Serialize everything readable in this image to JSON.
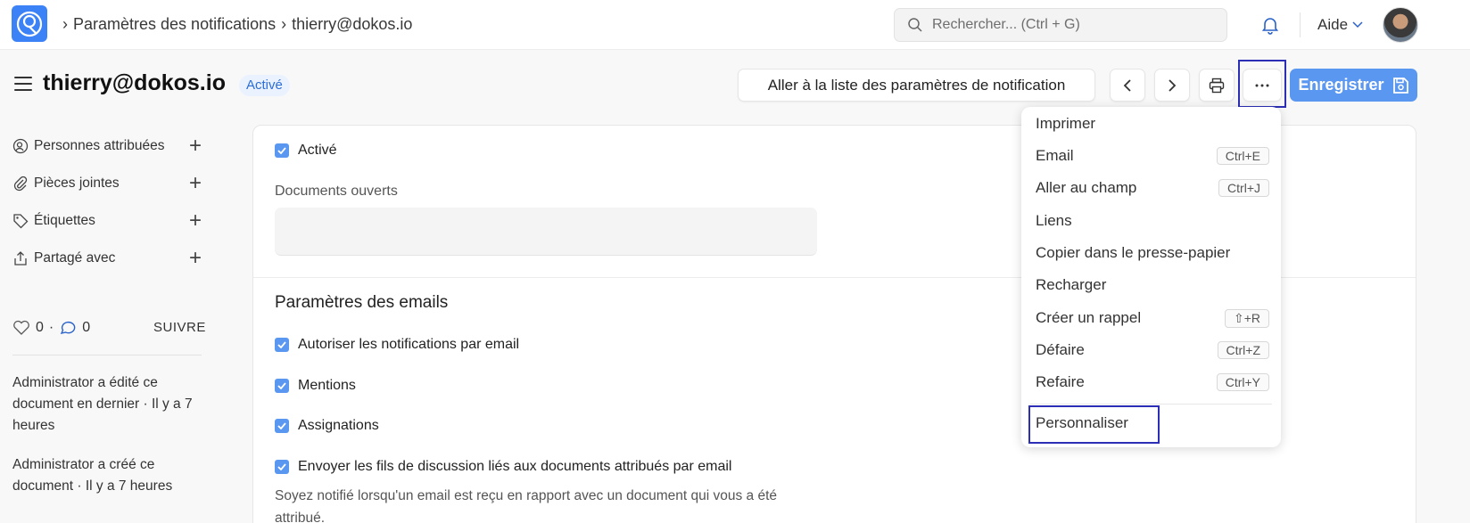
{
  "navbar": {
    "breadcrumb": [
      "Paramètres des notifications",
      "thierry@dokos.io"
    ],
    "search_placeholder": "Rechercher... (Ctrl + G)",
    "help_label": "Aide"
  },
  "header": {
    "title": "thierry@dokos.io",
    "status": "Activé",
    "list_button": "Aller à la liste des paramètres de notification",
    "save_button": "Enregistrer"
  },
  "sidebar": {
    "items": [
      {
        "label": "Personnes attribuées",
        "icon": "user-plus-icon"
      },
      {
        "label": "Pièces jointes",
        "icon": "paperclip-icon"
      },
      {
        "label": "Étiquettes",
        "icon": "tag-icon"
      },
      {
        "label": "Partagé avec",
        "icon": "share-icon"
      }
    ],
    "likes": "0",
    "comments": "0",
    "follow_label": "SUIVRE",
    "activity": [
      "Administrator a édité ce document en dernier · Il y a 7 heures",
      "Administrator a créé ce document · Il y a 7 heures"
    ]
  },
  "form": {
    "enabled_label": "Activé",
    "documents_label": "Documents ouverts",
    "email_section_title": "Paramètres des emails",
    "checkboxes": [
      "Autoriser les notifications par email",
      "Mentions",
      "Assignations",
      "Envoyer les fils de discussion liés aux documents attribués par email"
    ],
    "help_text": "Soyez notifié lorsqu'un email est reçu en rapport avec un document qui vous a été attribué."
  },
  "menu": {
    "items": [
      {
        "label": "Imprimer",
        "shortcut": ""
      },
      {
        "label": "Email",
        "shortcut": "Ctrl+E"
      },
      {
        "label": "Aller au champ",
        "shortcut": "Ctrl+J"
      },
      {
        "label": "Liens",
        "shortcut": ""
      },
      {
        "label": "Copier dans le presse-papier",
        "shortcut": ""
      },
      {
        "label": "Recharger",
        "shortcut": ""
      },
      {
        "label": "Créer un rappel",
        "shortcut": "⇧+R"
      },
      {
        "label": "Défaire",
        "shortcut": "Ctrl+Z"
      },
      {
        "label": "Refaire",
        "shortcut": "Ctrl+Y"
      }
    ],
    "customize": "Personnaliser"
  },
  "colors": {
    "primary": "#5a97f0",
    "highlight": "#2c2fb5"
  }
}
